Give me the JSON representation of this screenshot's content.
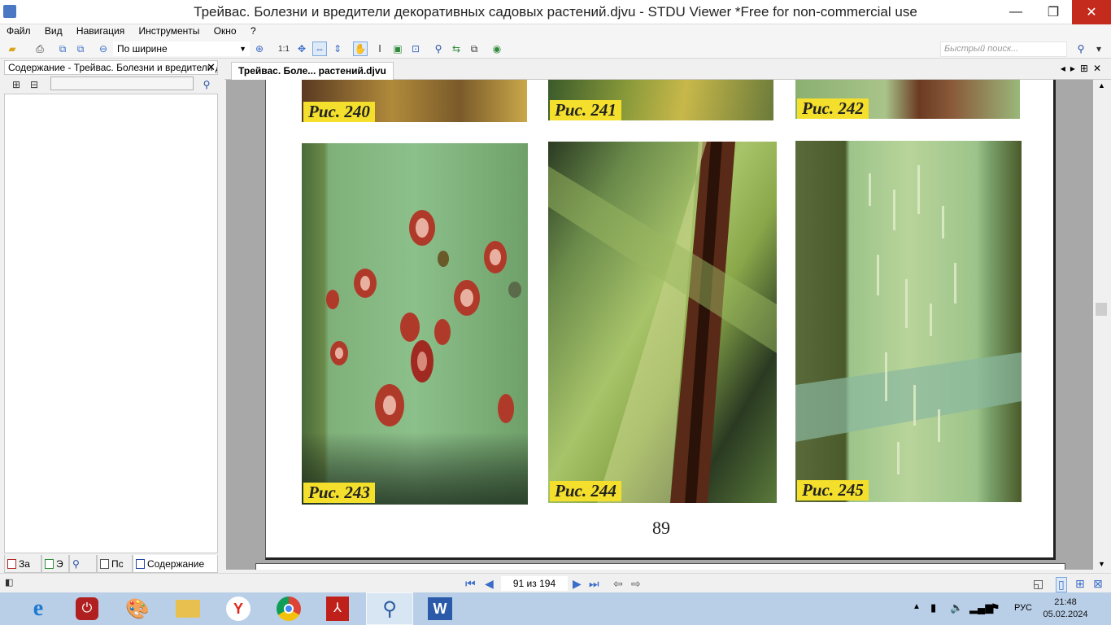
{
  "window": {
    "title": "Трейвас. Болезни и вредители декоративных садовых растений.djvu - STDU Viewer *Free for non-commercial use",
    "minimize": "—",
    "maximize": "❐",
    "close": "✕"
  },
  "menu": [
    "Файл",
    "Вид",
    "Навигация",
    "Инструменты",
    "Окно",
    "?"
  ],
  "toolbar": {
    "zoom_value": "По ширине",
    "actual_size_label": "1:1",
    "quick_search_placeholder": "Быстрый поиск..."
  },
  "left_panel": {
    "title": "Содержание - Трейвас. Болезни и вредители декоративных садовых растений",
    "tabs": [
      "За",
      "Э",
      "",
      "Пс",
      "Содержание"
    ]
  },
  "document": {
    "tab_label": "Трейвас. Боле... растений.djvu",
    "page_number": "89",
    "figures": [
      {
        "caption": "Рис. 240",
        "colors": [
          "#6b4a2a",
          "#c9a84a"
        ]
      },
      {
        "caption": "Рис. 241",
        "colors": [
          "#7a8a3a",
          "#c8b84a"
        ]
      },
      {
        "caption": "Рис. 242",
        "colors": [
          "#8ab070",
          "#6b3a22"
        ]
      },
      {
        "caption": "Рис. 243",
        "colors": [
          "#7fb07a",
          "#b03a2a"
        ]
      },
      {
        "caption": "Рис. 244",
        "colors": [
          "#a8c46a",
          "#5a2a18"
        ]
      },
      {
        "caption": "Рис. 245",
        "colors": [
          "#9cc48a",
          "#e0ecc8"
        ]
      }
    ]
  },
  "status": {
    "page_indicator": "91 из 194"
  },
  "taskbar": {
    "lang": "РУС",
    "time": "21:48",
    "date": "05.02.2024"
  }
}
